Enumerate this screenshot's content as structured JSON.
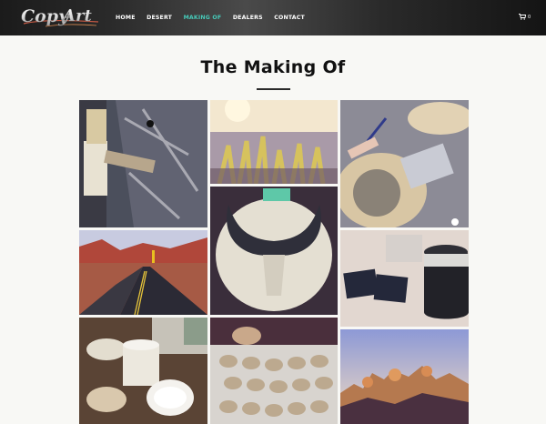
{
  "header": {
    "logo_text": "Copy Art",
    "nav": [
      {
        "label": "HOME",
        "active": false
      },
      {
        "label": "DESERT",
        "active": false
      },
      {
        "label": "MAKING OF",
        "active": true
      },
      {
        "label": "DEALERS",
        "active": false
      },
      {
        "label": "CONTACT",
        "active": false
      }
    ],
    "cart_count": "0",
    "accent_color": "#46c9b8"
  },
  "main": {
    "title": "The Making Of"
  },
  "gallery": {
    "photos": [
      {
        "subject": "paint brush on weathered board",
        "icon": "brush-icon"
      },
      {
        "subject": "cactus in desert light",
        "icon": "cactus-icon"
      },
      {
        "subject": "hand engraving cactus on wood slice",
        "icon": "engraving-icon"
      },
      {
        "subject": "desert highway",
        "icon": "road-icon"
      },
      {
        "subject": "wood slice painted with bull skull",
        "icon": "skull-icon"
      },
      {
        "subject": "business cards and mug",
        "icon": "cards-icon"
      },
      {
        "subject": "jars of paint and supplies",
        "icon": "jars-icon"
      },
      {
        "subject": "many small wood slice prints",
        "icon": "prints-icon"
      },
      {
        "subject": "desert rocks at sunset",
        "icon": "rocks-icon"
      }
    ]
  }
}
